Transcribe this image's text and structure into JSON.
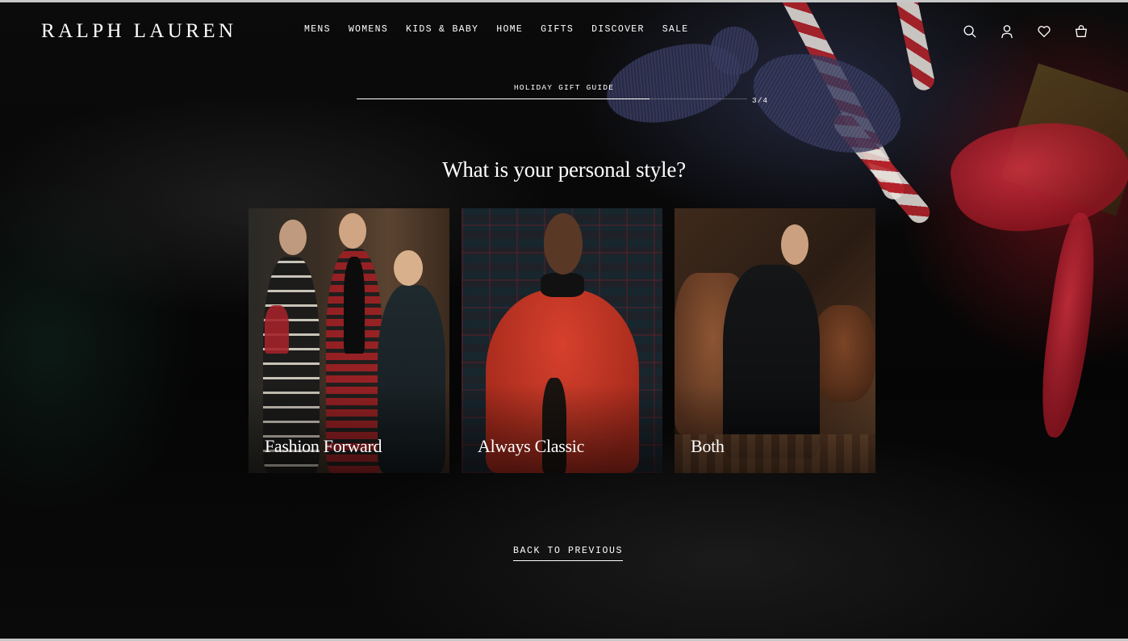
{
  "brand": {
    "logo_text": "RALPH LAUREN"
  },
  "nav": {
    "items": [
      {
        "label": "MENS"
      },
      {
        "label": "WOMENS"
      },
      {
        "label": "KIDS & BABY"
      },
      {
        "label": "HOME"
      },
      {
        "label": "GIFTS"
      },
      {
        "label": "DISCOVER"
      },
      {
        "label": "SALE"
      }
    ]
  },
  "header_icons": [
    "search-icon",
    "account-icon",
    "wishlist-heart-icon",
    "shopping-bag-icon"
  ],
  "quiz": {
    "guide_label": "HOLIDAY GIFT GUIDE",
    "step_counter": "3/4",
    "progress_fraction": 0.75,
    "question": "What is your personal style?",
    "options": [
      {
        "label": "Fashion Forward"
      },
      {
        "label": "Always Classic"
      },
      {
        "label": "Both"
      }
    ],
    "back_label": "BACK TO PREVIOUS"
  },
  "colors": {
    "text": "#ffffff",
    "background": "#050505",
    "accent_red": "#c0232d"
  }
}
